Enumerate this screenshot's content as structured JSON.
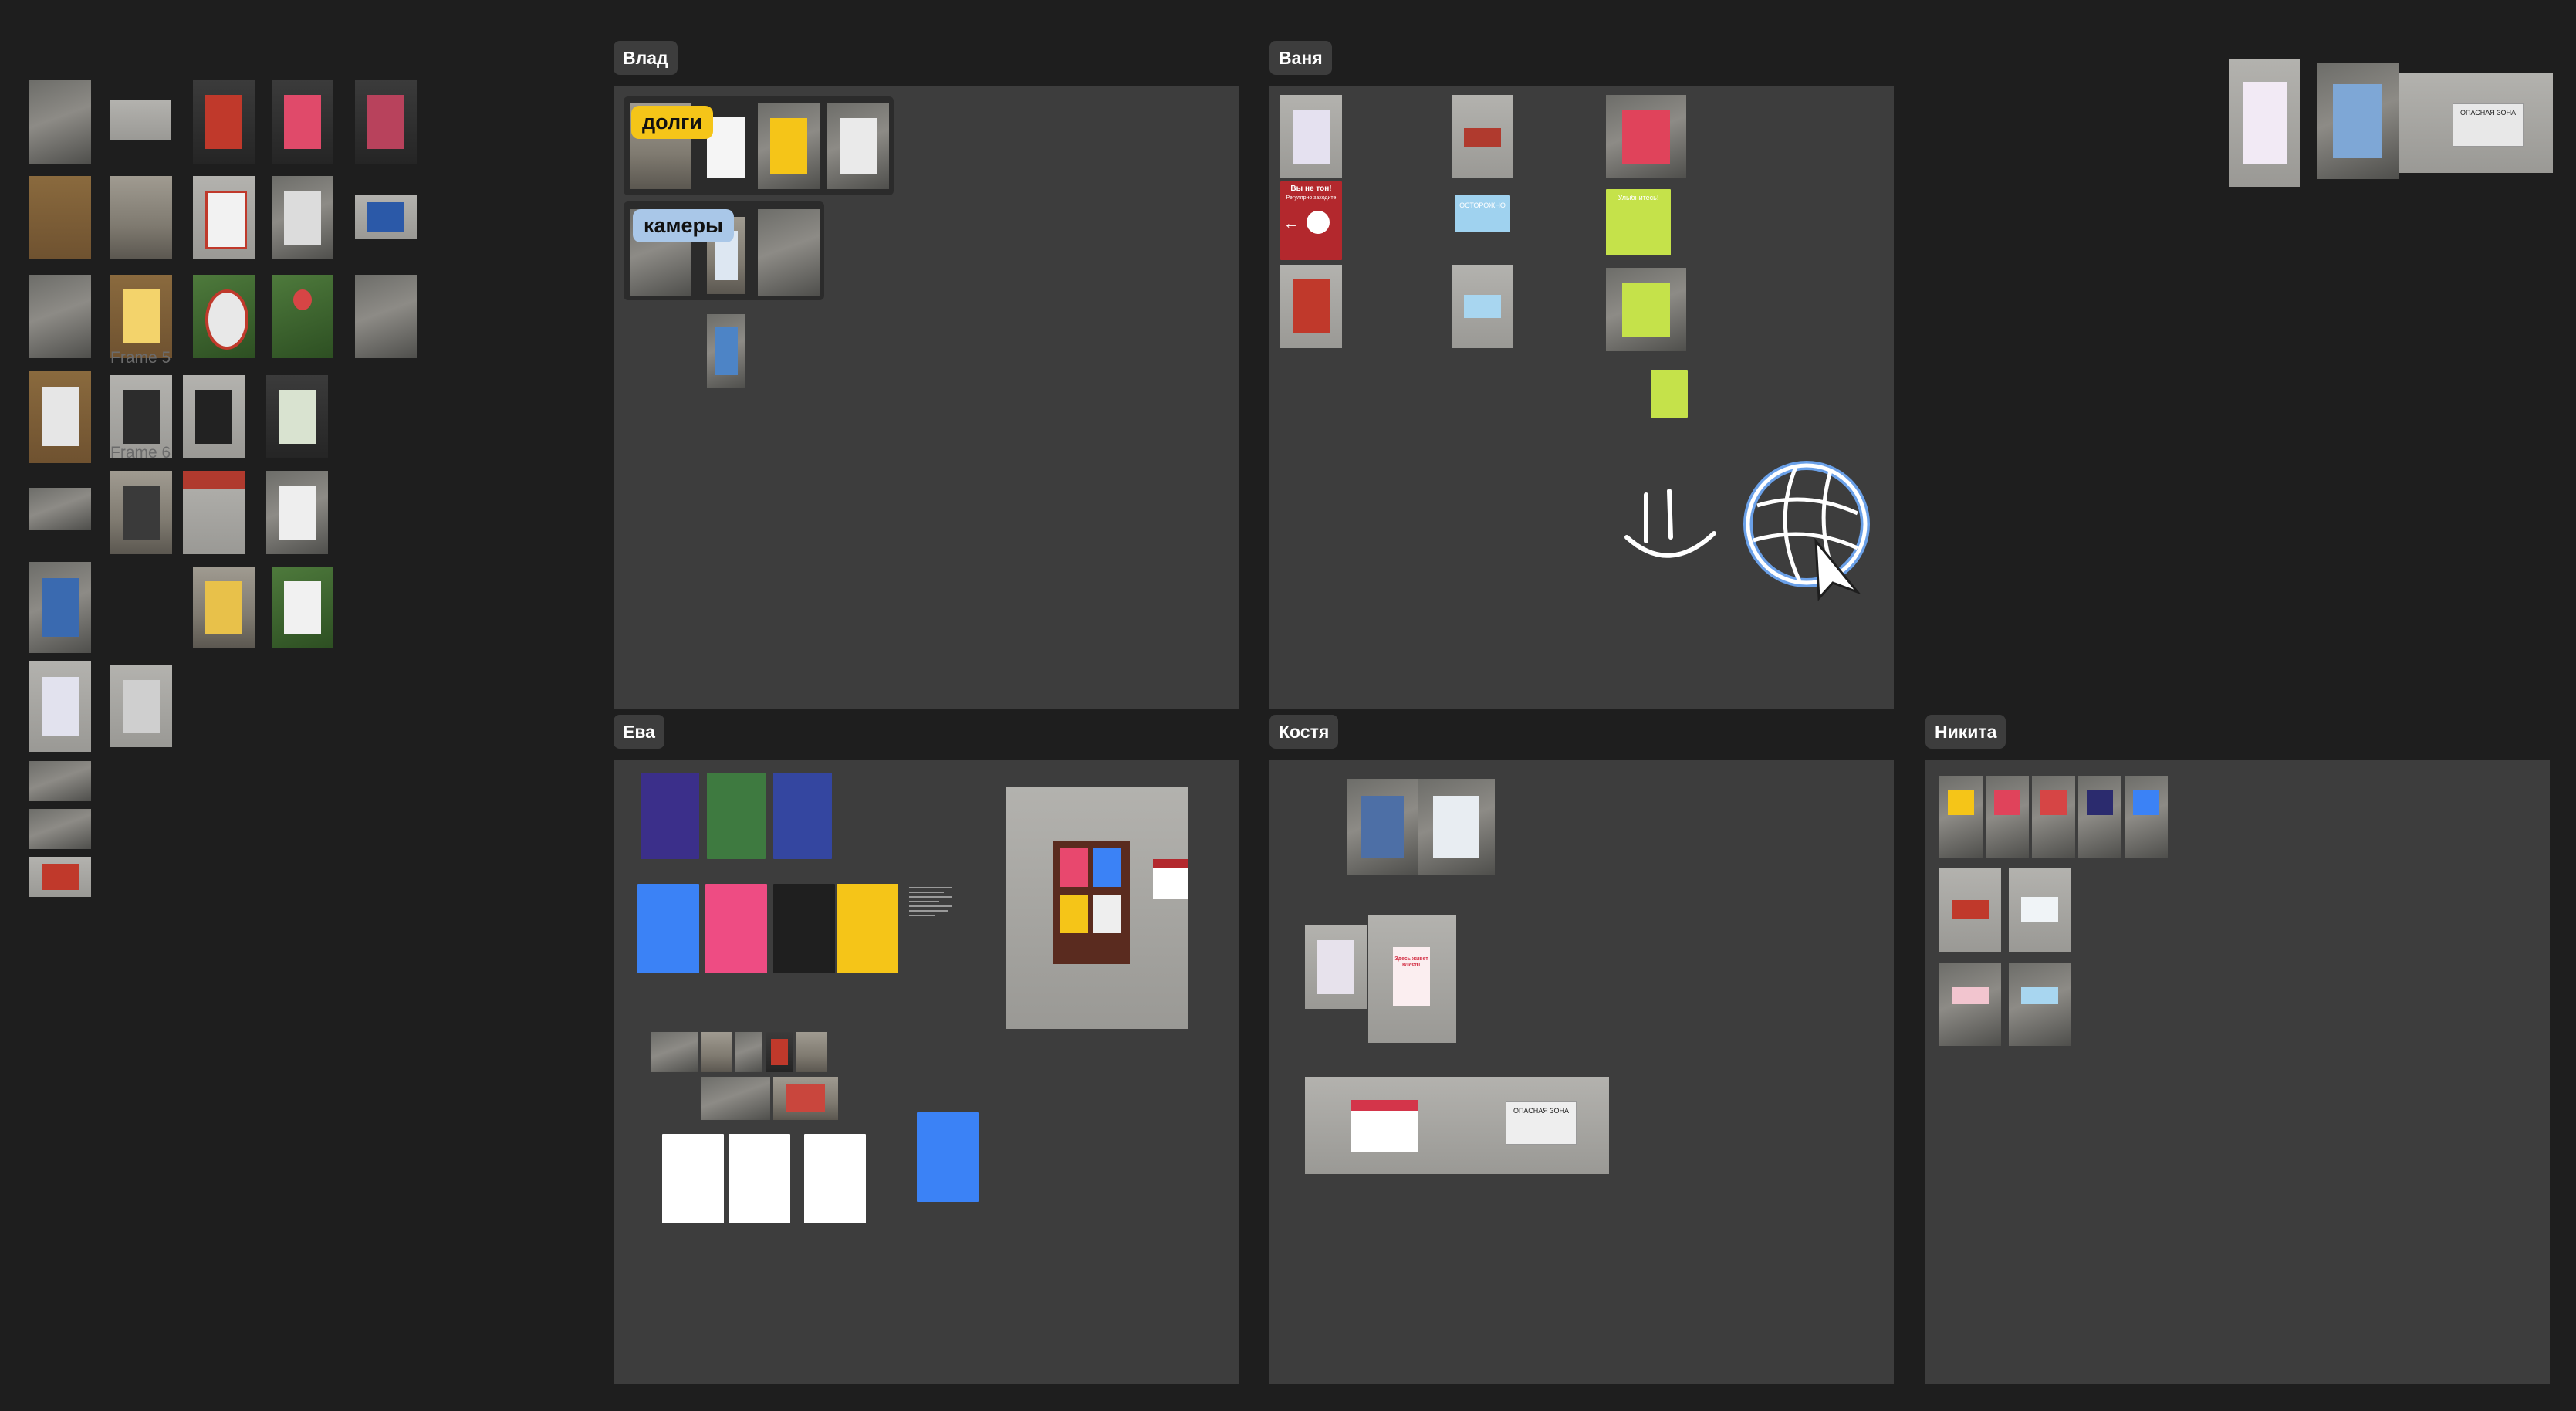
{
  "frames": {
    "vlad": {
      "label": "Влад"
    },
    "vanya": {
      "label": "Ваня"
    },
    "eva": {
      "label": "Ева"
    },
    "kostya": {
      "label": "Костя"
    },
    "nikita": {
      "label": "Никита"
    }
  },
  "left_labels": {
    "frame5": "Frame 5",
    "frame6": "Frame 6"
  },
  "stickers": {
    "dolgi": "долги",
    "kamery": "камеры"
  },
  "poster_texts": {
    "vanya_red_title": "Вы не тон!",
    "vanya_red_sub": "Регулярно заходите",
    "vanya_warning": "ОСТОРОЖНО",
    "vanya_green": "Улыбнитесь!",
    "kostya_sign_1": "Здесь живет клиент",
    "kostya_danger": "ОПАСНАЯ ЗОНА",
    "topright_sign": "ОПАСНАЯ ЗОНА"
  },
  "colors": {
    "canvas": "#1e1e1e",
    "frame": "#3d3d3d",
    "label_bg": "#3d3d3d",
    "yellow_sticker": "#f5c518",
    "blue_sticker": "#a9c7e8",
    "accent_blue": "#3b82f6"
  },
  "icons": {
    "smiley": "smiley-doodle-icon",
    "globe": "globe-cursor-icon"
  }
}
